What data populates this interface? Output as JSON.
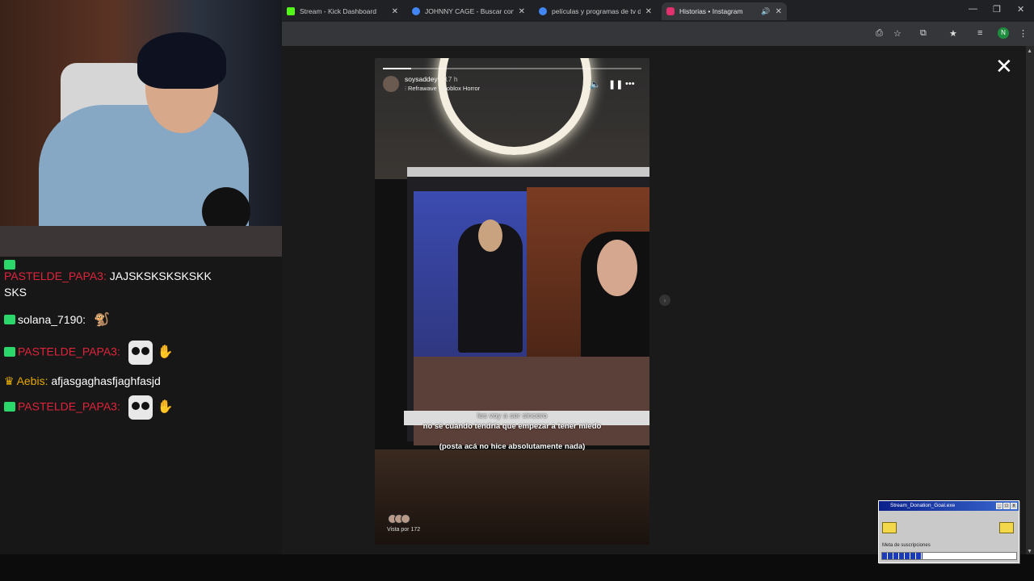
{
  "browser": {
    "tabs": [
      {
        "title": "Stream - Kick Dashboard",
        "favicon_color": "#53fc18",
        "active": false
      },
      {
        "title": "JOHNNY CAGE - Buscar con Go",
        "favicon_color": "#4285f4",
        "active": false
      },
      {
        "title": "películas y programas de tv de",
        "favicon_color": "#4285f4",
        "active": false
      },
      {
        "title": "Historias • Instagram",
        "favicon_color": "#e1306c",
        "active": true
      }
    ],
    "profile_initial": "N"
  },
  "story": {
    "username": "soysaddey",
    "time": "17 h",
    "music": "Refrawave · Roblox Horror",
    "progress": 0.11,
    "caption_top": "les voy a ser sincero",
    "caption_mid": "no sé cuándo tendría que empezar a tener miedo",
    "caption_bottom": "(posta acá no hice absolutamente nada)",
    "viewers": "Vista por 172"
  },
  "chat": {
    "messages": [
      {
        "user": "PASTELDE_PAPA3:",
        "text": "JAJSKSKSKSKSKK",
        "text2": "SKS"
      },
      {
        "user": "solana_7190:",
        "text": ""
      },
      {
        "user": "PASTELDE_PAPA3:",
        "text": ""
      },
      {
        "user": "Aebis:",
        "text": "afjasgaghasfjaghfasjd"
      },
      {
        "user": "PASTELDE_PAPA3:",
        "text": ""
      }
    ]
  },
  "donation": {
    "title": "Stream_Donation_Goal.exe",
    "label": "Meta de suscripciones",
    "progress": 0.3
  },
  "colors": {
    "kick_green": "#53fc18",
    "chat_red": "#e0243b",
    "gold": "#e6a800"
  }
}
